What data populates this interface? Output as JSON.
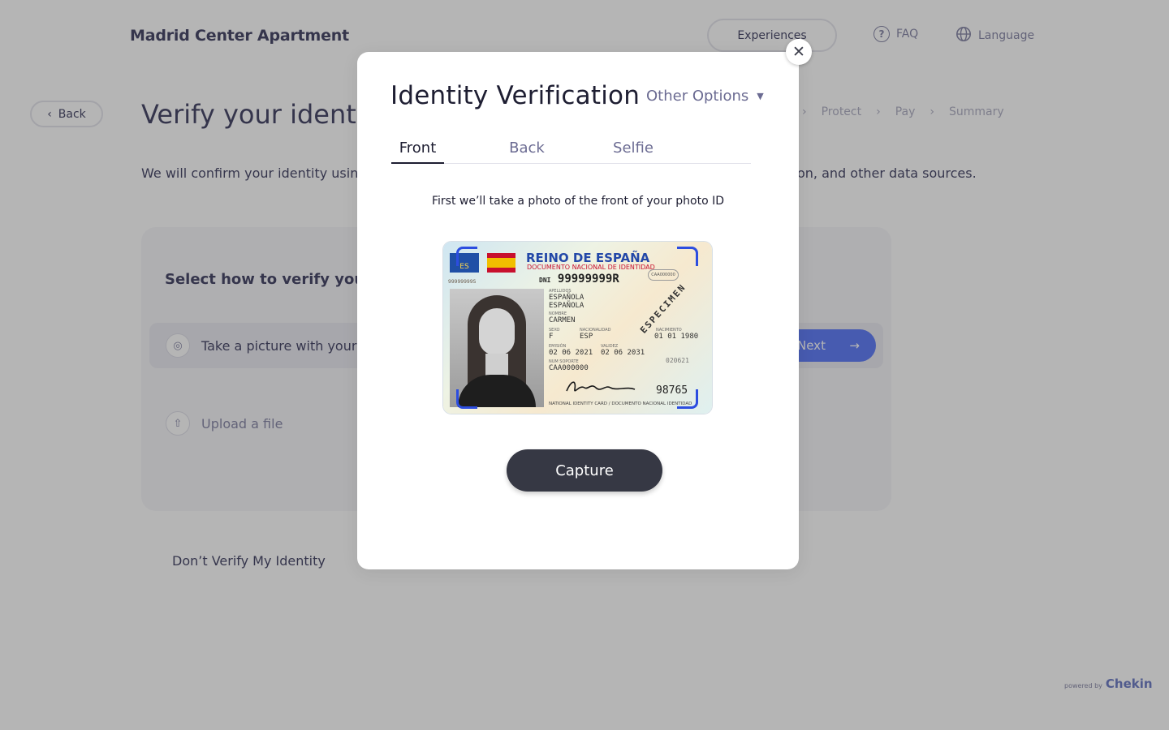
{
  "header": {
    "brand": "Madrid Center Apartment",
    "experiences": "Experiences",
    "faq": "FAQ",
    "language": "Language"
  },
  "page": {
    "back_label": "Back",
    "title": "Verify your identity",
    "steps": [
      "Protect",
      "Pay",
      "Summary"
    ],
    "lead_start": "We will confirm your identity using",
    "lead_end": "on, and other data sources.",
    "panel_title": "Select how to verify your id",
    "option_camera": "Take a picture with your",
    "option_upload": "Upload a file",
    "next_label": "Next",
    "dont_verify": "Don’t Verify My Identity",
    "powered_by": "powered by",
    "powered_logo": "Chekin"
  },
  "modal": {
    "title": "Identity Verification",
    "other_options": "Other Options",
    "tabs": [
      "Front",
      "Back",
      "Selfie"
    ],
    "active_tab": "Front",
    "instruction": "First we’ll take a photo of the front of your photo ID",
    "capture_label": "Capture"
  },
  "id_card": {
    "eu_code": "ES",
    "country": "REINO DE ESPAÑA",
    "doc_type": "DOCUMENTO NACIONAL DE IDENTIDAD",
    "small_number": "99999999S",
    "dni_label": "DNI",
    "dni_number": "99999999R",
    "chip_code": "CAA000000",
    "label_apellidos": "APELLIDOS",
    "surname1": "ESPAÑOLA",
    "surname2": "ESPAÑOLA",
    "label_nombre": "NOMBRE",
    "name": "CARMEN",
    "label_sexo": "SEXO",
    "sex": "F",
    "label_nacionalidad": "NACIONALIDAD",
    "nationality": "ESP",
    "label_nacimiento": "NACIMIENTO",
    "birth": "01 01 1980",
    "label_emision": "EMISIÓN",
    "issue": "02 06 2021",
    "label_validez": "VALIDEZ",
    "validity": "02 06 2031",
    "label_soporte": "NUM SOPORTE",
    "support": "CAA000000",
    "code": "020621",
    "specimen": "ESPECIMEN",
    "big_number": "98765",
    "footer": "NATIONAL IDENTITY CARD / DOCUMENTO NACIONAL IDENTIDAD"
  },
  "colors": {
    "accent": "#385cf6",
    "capture": "#363844",
    "overlay": "rgba(92,92,92,0.45)",
    "scan_corners": "#2c4de0"
  }
}
